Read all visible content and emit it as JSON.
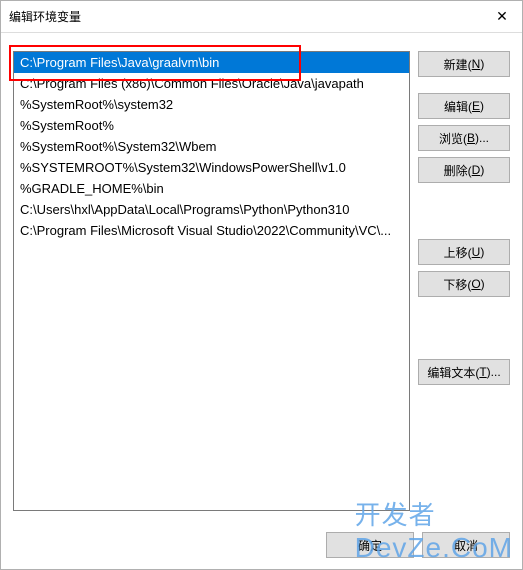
{
  "window": {
    "title": "编辑环境变量",
    "close_glyph": "✕"
  },
  "list": {
    "items": [
      "C:\\Program Files\\Java\\graalvm\\bin",
      "C:\\Program Files (x86)\\Common Files\\Oracle\\Java\\javapath",
      "%SystemRoot%\\system32",
      "%SystemRoot%",
      "%SystemRoot%\\System32\\Wbem",
      "%SYSTEMROOT%\\System32\\WindowsPowerShell\\v1.0",
      "%GRADLE_HOME%\\bin",
      "C:\\Users\\hxl\\AppData\\Local\\Programs\\Python\\Python310",
      "C:\\Program Files\\Microsoft Visual Studio\\2022\\Community\\VC\\..."
    ],
    "selected_index": 0
  },
  "buttons": {
    "new": {
      "label": "新建(",
      "key": "N",
      "suffix": ")"
    },
    "edit": {
      "label": "编辑(",
      "key": "E",
      "suffix": ")"
    },
    "browse": {
      "label": "浏览(",
      "key": "B",
      "suffix": ")..."
    },
    "delete": {
      "label": "删除(",
      "key": "D",
      "suffix": ")"
    },
    "moveup": {
      "label": "上移(",
      "key": "U",
      "suffix": ")"
    },
    "movedown": {
      "label": "下移(",
      "key": "O",
      "suffix": ")"
    },
    "edittext": {
      "label": "编辑文本(",
      "key": "T",
      "suffix": ")..."
    }
  },
  "footer": {
    "ok": "确定",
    "cancel": "取消"
  },
  "watermark": {
    "cn": "开发者",
    "en": "DevZe.CoM"
  }
}
